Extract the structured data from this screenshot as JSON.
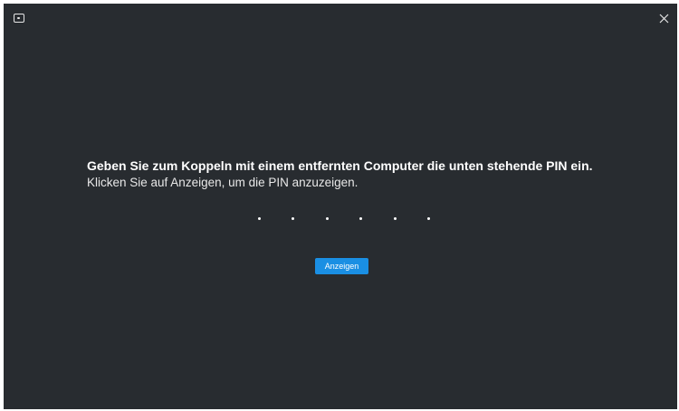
{
  "window": {
    "app_icon": "screen-share-icon",
    "close_icon": "close-icon"
  },
  "main": {
    "heading": "Geben Sie zum Koppeln mit einem entfernten Computer die unten stehende PIN ein.",
    "instruction": "Klicken Sie auf Anzeigen, um die PIN anzuzeigen.",
    "pin_masked_digits": 6,
    "show_button_label": "Anzeigen"
  },
  "colors": {
    "background": "#282c30",
    "accent": "#1a8fe3",
    "text": "#ffffff"
  }
}
